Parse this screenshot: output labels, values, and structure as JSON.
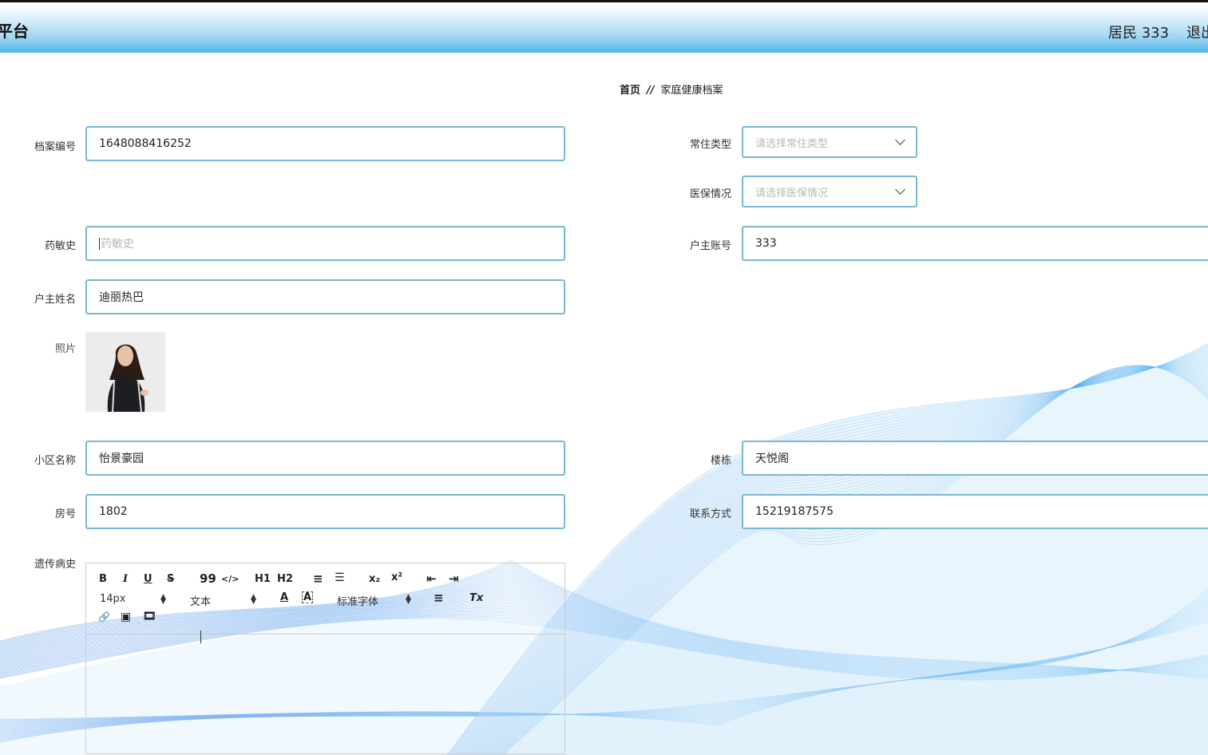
{
  "header": {
    "title": "平台",
    "user": "居民 333",
    "logout": "退出"
  },
  "breadcrumb": {
    "home": "首页",
    "separator": "//",
    "current": "家庭健康档案"
  },
  "form": {
    "archive_no": {
      "label": "档案编号",
      "value": "1648088416252"
    },
    "residence_type": {
      "label": "常住类型",
      "placeholder": "请选择常住类型"
    },
    "insurance": {
      "label": "医保情况",
      "placeholder": "请选择医保情况"
    },
    "allergy": {
      "label": "药敏史",
      "placeholder": "药敏史"
    },
    "owner_account": {
      "label": "户主账号",
      "value": "333"
    },
    "owner_name": {
      "label": "户主姓名",
      "value": "迪丽热巴"
    },
    "photo": {
      "label": "照片"
    },
    "community": {
      "label": "小区名称",
      "value": "怡景豪园"
    },
    "building": {
      "label": "楼栋",
      "value": "天悦阁"
    },
    "room": {
      "label": "房号",
      "value": "1802"
    },
    "contact": {
      "label": "联系方式",
      "value": "15219187575"
    },
    "genetic": {
      "label": "遗传病史"
    }
  },
  "editor": {
    "toolbar": {
      "bold": "B",
      "italic": "I",
      "underline": "U",
      "strike": "S",
      "quote": "99",
      "code": "</>",
      "h1": "H1",
      "h2": "H2",
      "ordered_list": "≡",
      "bullet_list": "☰",
      "subscript": "x₂",
      "superscript": "x²",
      "outdent": "⇤",
      "indent": "⇥",
      "size": "14px",
      "header": "文本",
      "color": "A",
      "background": "A",
      "font": "标准字体",
      "align": "≡",
      "clean": "Tx",
      "link": "🔗",
      "image": "▣",
      "video": "🎞"
    }
  },
  "colors": {
    "accent": "#4fb3e8",
    "field_border": "#7ab7d1",
    "wave": "#2a7fe0"
  }
}
